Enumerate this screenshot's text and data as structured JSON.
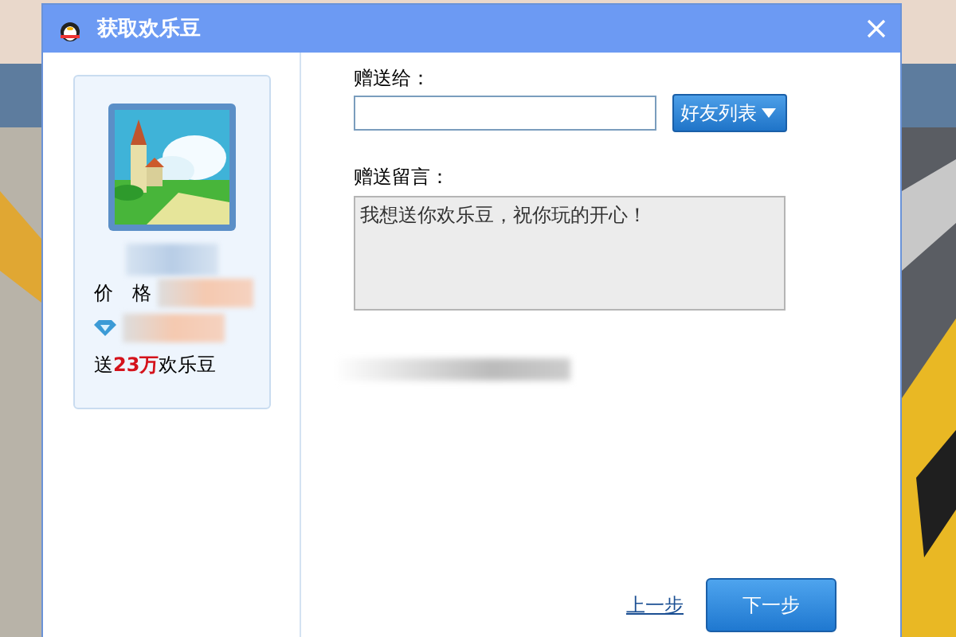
{
  "window": {
    "title": "获取欢乐豆"
  },
  "gift": {
    "kind": "picture",
    "price_label": "价　格",
    "reward": "送**23万**欢乐豆"
  },
  "recipient": {
    "label": "赠送给：",
    "friends_button": "好友列表"
  },
  "message": {
    "label": "赠送留言：",
    "value": "我想送你欢乐豆，祝你玩的开心！"
  },
  "buttons": {
    "back": "上一步",
    "next": "下一步"
  }
}
